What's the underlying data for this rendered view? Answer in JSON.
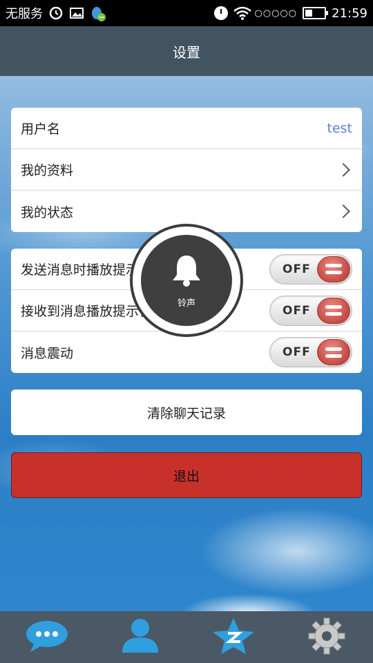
{
  "statusbar": {
    "carrier": "无服务",
    "signal_dots": "○○○○○",
    "time": "21:59"
  },
  "header": {
    "title": "设置"
  },
  "account": {
    "username_label": "用户名",
    "username_value": "test",
    "profile_label": "我的资料",
    "status_label": "我的状态"
  },
  "notifications": {
    "send_sound_label": "发送消息时播放提示音",
    "receive_sound_label": "接收到消息播放提示音",
    "vibrate_label": "消息震动",
    "toggle_text": "OFF"
  },
  "actions": {
    "clear_history": "清除聊天记录",
    "logout": "退出"
  },
  "toast": {
    "label": "铃声"
  },
  "colors": {
    "header_bg": "#425462",
    "logout_bg": "#c8312a",
    "accent_value": "#5b7fd9"
  },
  "bottomnav": {
    "icons": [
      "chat-icon",
      "contacts-icon",
      "qzone-star-icon",
      "settings-gear-icon"
    ]
  }
}
